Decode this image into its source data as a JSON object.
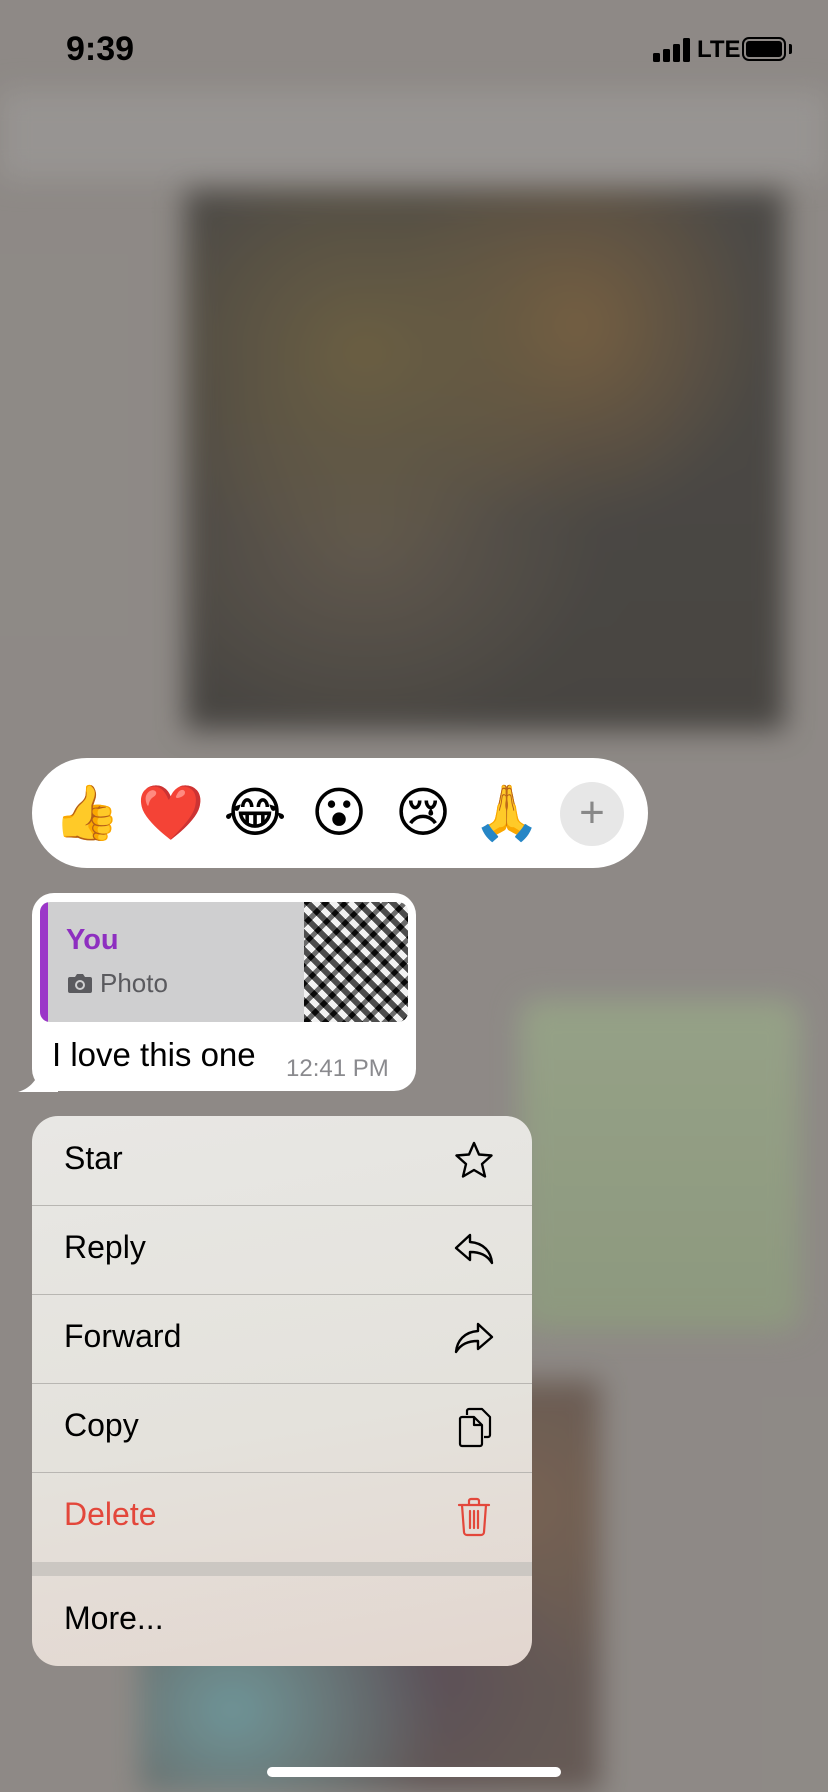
{
  "status_bar": {
    "time": "9:39",
    "network": "LTE"
  },
  "reactions": [
    {
      "emoji": "👍",
      "name": "thumbs-up"
    },
    {
      "emoji": "❤️",
      "name": "red-heart"
    },
    {
      "emoji": "😂",
      "name": "tears-of-joy"
    },
    {
      "emoji": "😮",
      "name": "surprised"
    },
    {
      "emoji": "😢",
      "name": "crying"
    },
    {
      "emoji": "🙏",
      "name": "folded-hands"
    }
  ],
  "reaction_more_label": "+",
  "message": {
    "quote_author": "You",
    "quote_type": "Photo",
    "text": "I love this one",
    "time": "12:41 PM"
  },
  "menu": {
    "items": [
      {
        "label": "Star",
        "icon": "star-icon"
      },
      {
        "label": "Reply",
        "icon": "reply-icon"
      },
      {
        "label": "Forward",
        "icon": "forward-icon"
      },
      {
        "label": "Copy",
        "icon": "copy-icon"
      },
      {
        "label": "Delete",
        "icon": "trash-icon",
        "destructive": true
      }
    ],
    "more_label": "More..."
  },
  "colors": {
    "quote_accent": "#9b37c8",
    "quote_author": "#8e2fc0",
    "destructive": "#e3473b"
  }
}
